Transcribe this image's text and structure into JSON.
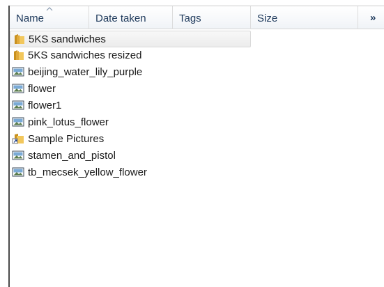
{
  "columns": {
    "name": "Name",
    "date_taken": "Date taken",
    "tags": "Tags",
    "size": "Size",
    "more": "»"
  },
  "items": [
    {
      "label": "5KS sandwiches",
      "type": "folder",
      "icon": "folder-icon",
      "selected": true
    },
    {
      "label": "5KS sandwiches resized",
      "type": "folder",
      "icon": "folder-icon",
      "selected": false
    },
    {
      "label": "beijing_water_lily_purple",
      "type": "image",
      "icon": "image-file-icon",
      "selected": false
    },
    {
      "label": "flower",
      "type": "image",
      "icon": "image-file-icon",
      "selected": false
    },
    {
      "label": "flower1",
      "type": "image",
      "icon": "image-file-icon",
      "selected": false
    },
    {
      "label": "pink_lotus_flower",
      "type": "image",
      "icon": "image-file-icon",
      "selected": false
    },
    {
      "label": "Sample Pictures",
      "type": "shortcut",
      "icon": "shortcut-icon",
      "selected": false
    },
    {
      "label": "stamen_and_pistol",
      "type": "image",
      "icon": "image-file-icon",
      "selected": false
    },
    {
      "label": "tb_mecsek_yellow_flower",
      "type": "image",
      "icon": "image-file-icon",
      "selected": false
    }
  ],
  "colors": {
    "header_text": "#1e395b",
    "folder": "#e8b84a",
    "selection": "#ececec"
  }
}
